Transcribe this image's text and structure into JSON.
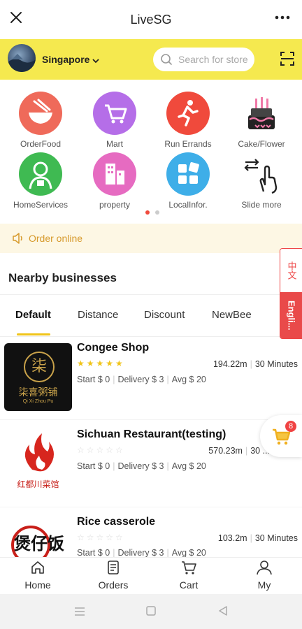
{
  "header": {
    "title": "LiveSG"
  },
  "location": {
    "label": "Singapore"
  },
  "search": {
    "placeholder": "Search for store"
  },
  "categories": [
    {
      "label": "OrderFood",
      "color": "#ef6a5a",
      "icon": "noodle-bowl-icon"
    },
    {
      "label": "Mart",
      "color": "#b56ee8",
      "icon": "shopping-cart-icon"
    },
    {
      "label": "Run Errands",
      "color": "#f04a3c",
      "icon": "running-man-icon"
    },
    {
      "label": "Cake/Flower",
      "color": "#ffffff",
      "icon": "cake-icon"
    },
    {
      "label": "HomeServices",
      "color": "#3fba52",
      "icon": "home-service-person-icon"
    },
    {
      "label": "property",
      "color": "#e66bc1",
      "icon": "building-icon"
    },
    {
      "label": "LocalInfor.",
      "color": "#3eaee8",
      "icon": "tiles-icon"
    },
    {
      "label": "Slide more",
      "color": "#ffffff",
      "icon": "slide-hand-icon"
    }
  ],
  "banner": {
    "label": "Order online"
  },
  "section": {
    "title": "Nearby businesses"
  },
  "tabs": [
    "Default",
    "Distance",
    "Discount",
    "NewBee"
  ],
  "lang": {
    "zh": "中文",
    "en": "Engli..."
  },
  "businesses": [
    {
      "name": "Congee Shop",
      "rating": 5,
      "distance": "194.22m",
      "time": "30 Minutes",
      "start": "Start  $ 0",
      "delivery": "Delivery  $ 3",
      "avg": "Avg  $ 20"
    },
    {
      "name": "Sichuan Restaurant(testing)",
      "rating": 0,
      "distance": "570.23m",
      "time": "30 ...",
      "start": "Start  $ 0",
      "delivery": "Delivery  $ 3",
      "avg": "Avg  $ 20"
    },
    {
      "name": "Rice casserole",
      "rating": 0,
      "distance": "103.2m",
      "time": "30 Minutes",
      "start": "Start  $ 0",
      "delivery": "Delivery  $ 3",
      "avg": "Avg  $ 20"
    }
  ],
  "logos": {
    "congee_big": "柒",
    "congee_name": "柒喜粥铺",
    "congee_sub": "Qi Xi Zhou Pu",
    "sichuan": "红都川菜馆",
    "rice": "煲仔饭"
  },
  "cart": {
    "count": "8"
  },
  "nav": [
    {
      "label": "Home",
      "icon": "home-icon"
    },
    {
      "label": "Orders",
      "icon": "orders-icon"
    },
    {
      "label": "Cart",
      "icon": "cart-icon"
    },
    {
      "label": "My",
      "icon": "user-icon"
    }
  ],
  "colors": {
    "accent_yellow": "#f5e94f",
    "star_yellow": "#f0c419",
    "banner_text": "#d79a2c",
    "lang_red": "#e94a4a"
  }
}
